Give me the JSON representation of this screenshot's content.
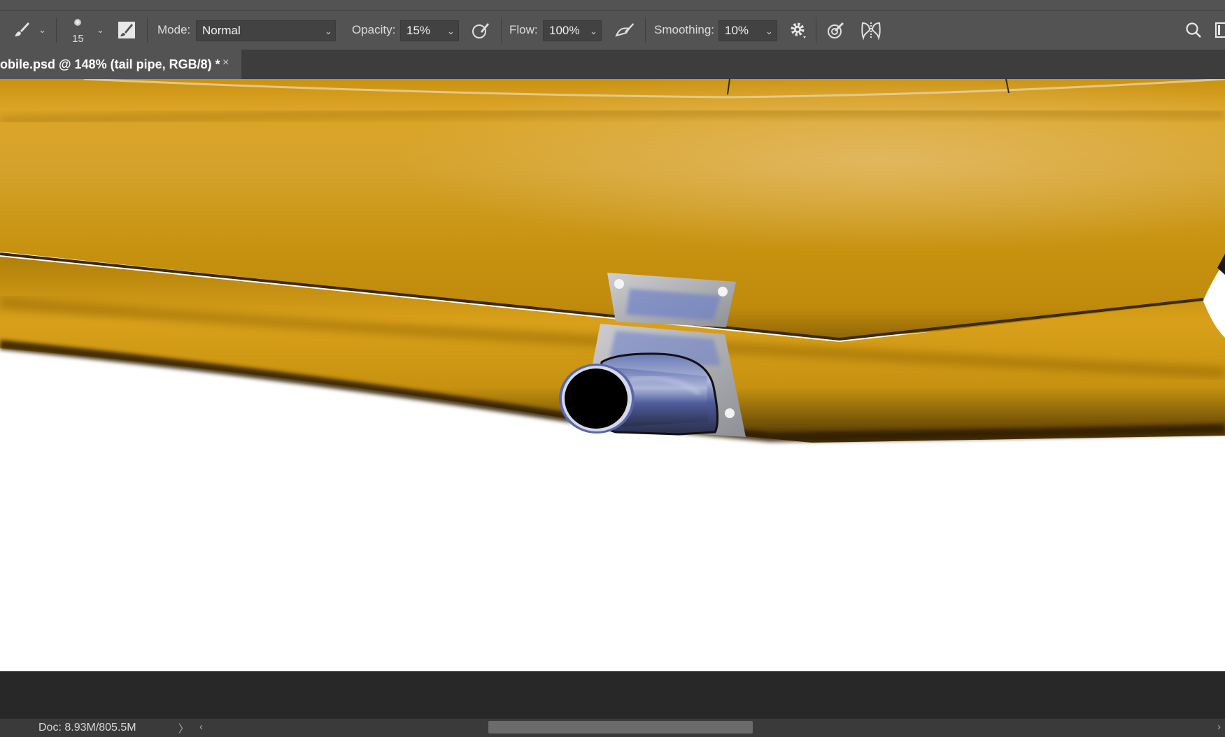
{
  "options": {
    "brush_size": "15",
    "mode_label": "Mode:",
    "mode_value": "Normal",
    "opacity_label": "Opacity:",
    "opacity_value": "15%",
    "flow_label": "Flow:",
    "flow_value": "100%",
    "smoothing_label": "Smoothing:",
    "smoothing_value": "10%"
  },
  "document_tab": {
    "title": "obile.psd @ 148% (tail pipe, RGB/8) *",
    "close": "×"
  },
  "status": {
    "doc_size": "Doc: 8.93M/805.5M",
    "right_arrow": "〉",
    "scroll_left": "‹",
    "scroll_right": "›"
  },
  "icons": [
    "brush-tool-icon",
    "brush-preview-icon",
    "brush-panel-toggle-icon",
    "pressure-opacity-icon",
    "airbrush-icon",
    "gear-icon",
    "angle-icon",
    "symmetry-icon",
    "search-icon",
    "workspace-icon"
  ],
  "colors": {
    "car_body": "#D7A01A",
    "car_shadow": "#5A3F04",
    "pipe_blue": "#5B6DB0",
    "ui_panel": "#535353"
  }
}
